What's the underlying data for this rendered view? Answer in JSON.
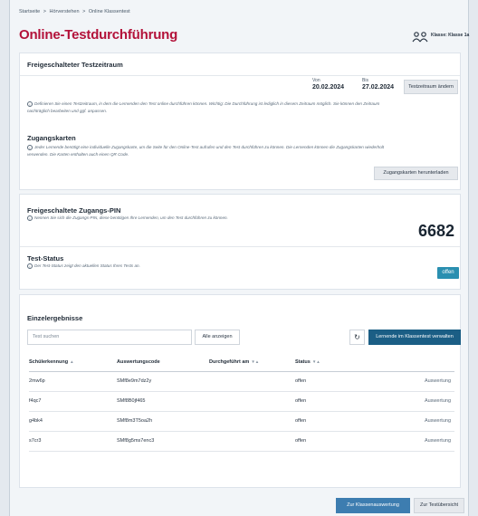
{
  "breadcrumb": [
    "Startseite",
    ">",
    "Hörverstehen",
    ">",
    "Online Klassentest"
  ],
  "page_title": "Online-Testdurchführung",
  "class_label": "Klasse: Klasse 1a",
  "period": {
    "heading": "Freigeschalteter Testzeitraum",
    "from_label": "Von",
    "from_date": "20.02.2024",
    "to_label": "Bis",
    "to_date": "27.02.2024",
    "change_button": "Testzeitraum ändern",
    "note_line1": "Definieren Sie einen Testzeitraum, in dem die Lernenden den Test online durchführen können. Wichtig: Die Durchführung ist lediglich in diesem Zeitraum möglich. Sie können den Zeitraum",
    "note_line2": "nachträglich bearbeiten und ggf. anpassen."
  },
  "access_cards": {
    "heading": "Zugangskarten",
    "note_line1": "Jeder Lernende benötigt eine individuelle Zugangskarte, um die Seite für den Online-Test aufrufen und den Test durchführen zu können. Die Lernenden können die Zugangskarten wiederholt",
    "note_line2": "verwenden. Die Karten enthalten auch einen QR Code.",
    "download_button": "Zugangskarten herunterladen"
  },
  "pin": {
    "heading": "Freigeschaltete Zugangs-PIN",
    "note": "Nennen Sie sich die Zugangs-PIN, diese benötigen Ihre Lernenden, um den Test durchführen zu können.",
    "value": "6682"
  },
  "status": {
    "heading": "Test-Status",
    "note": "Der Test-Status zeigt den aktuellen Status Ihres Tests an.",
    "badge": "offen",
    "badge_color": "#2a8fb0"
  },
  "results": {
    "heading": "Einzelergebnisse",
    "search_placeholder": "Test suchen",
    "show_all_button": "Alle anzeigen",
    "manage_button": "Lernende im Klassentest verwalten",
    "columns": [
      "Schülerkennung",
      "Auswertungscode",
      "Durchgeführt am",
      "Status"
    ],
    "sort_up": "▲",
    "sort_both": "▼▲",
    "rows": [
      {
        "id": "2mw6p",
        "code": "SMf8e9m7dz2y",
        "date": "",
        "status": "offen",
        "action": "Auswertung"
      },
      {
        "id": "f4qc7",
        "code": "SMf8B0jf465",
        "date": "",
        "status": "offen",
        "action": "Auswertung"
      },
      {
        "id": "g4bk4",
        "code": "SMf8m3T5oa2h",
        "date": "",
        "status": "offen",
        "action": "Auswertung"
      },
      {
        "id": "s7cr3",
        "code": "SMf8g5ms7enc3",
        "date": "",
        "status": "offen",
        "action": "Auswertung"
      }
    ]
  },
  "footer": {
    "class_eval_button": "Zur Klassenauswertung",
    "overview_button": "Zur Testübersicht"
  }
}
